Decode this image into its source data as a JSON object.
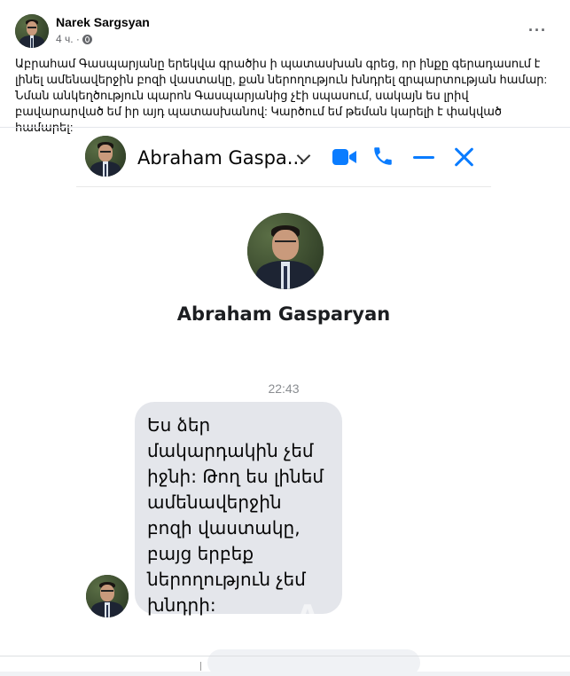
{
  "post": {
    "author": "Narek Sargsyan",
    "time": "4 ч. ·",
    "more_label": "···",
    "text": "Աբրահամ Գասպարյանը երեկվա գրածիս ի պատասխան գրեց, որ ինքը գերադասում է լինել ամենավերջին բոզի վաստակը, քան ներողություն խնդրել զրպարտության համար: Նման անկեղծություն պարոն Գասպարյանից չէի սպասում, սակայն ես լրիվ բավարարված եմ իր այդ պատասխանով: Կարծում եմ թեման կարելի է փակված համարել:"
  },
  "chat": {
    "header_name": "Abraham Gaspa...",
    "profile_name": "Abraham Gasparyan",
    "timestamp": "22:43",
    "message": "Ես ձեր մակարդակին չեմ իջնի: Թող ես լինեմ ամենավերջին բոզի վաստակը, բայց երբեք ներողություն չեմ խնդրի:",
    "watermark": "A",
    "icons": [
      "video-icon",
      "phone-icon",
      "minimize-icon",
      "close-icon",
      "chevron-down-icon"
    ],
    "accent_color": "#0a7cff"
  }
}
